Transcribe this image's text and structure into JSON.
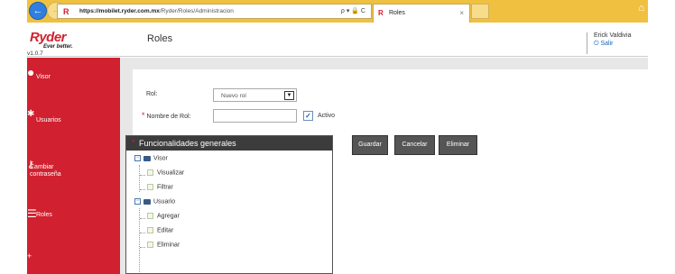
{
  "browser": {
    "url_host": "https://mobilet.ryder.com.mx",
    "url_path": "/Ryder/Roles/Administracion",
    "url_tools": "ρ ▾ 🔒 C",
    "tab_title": "Roles",
    "tab_close": "×"
  },
  "header": {
    "brand": "Ryder",
    "slogan": "Ever better.",
    "version": "v1.0.7",
    "page_title": "Roles",
    "user_name": "Erick Valdivia",
    "logout_label": "Salir"
  },
  "sidebar": {
    "items": [
      {
        "label": "Visor",
        "icon": "map-pin-icon"
      },
      {
        "label": "Usuarios",
        "icon": "users-icon"
      },
      {
        "label": "Cambiar\ncontraseña",
        "icon": "key-icon"
      },
      {
        "label": "Roles",
        "icon": "list-icon"
      }
    ]
  },
  "form": {
    "rol_label": "Rol:",
    "rol_selected": "Nuevo rol",
    "nombre_label": "Nombre de Rol:",
    "nombre_value": "",
    "activo_label": "Activo",
    "activo_checked": true
  },
  "functions": {
    "title": "Funcionalidades generales",
    "groups": [
      {
        "label": "Visor",
        "children": [
          "Visualizar",
          "Filtrar"
        ]
      },
      {
        "label": "Usuario",
        "children": [
          "Agregar",
          "Editar",
          "Eliminar"
        ]
      }
    ]
  },
  "buttons": {
    "save": "Guardar",
    "cancel": "Cancelar",
    "delete": "Eliminar"
  },
  "colors": {
    "brand_red": "#d1202f",
    "chrome_bar": "#f0c040",
    "button_gray": "#555555"
  }
}
